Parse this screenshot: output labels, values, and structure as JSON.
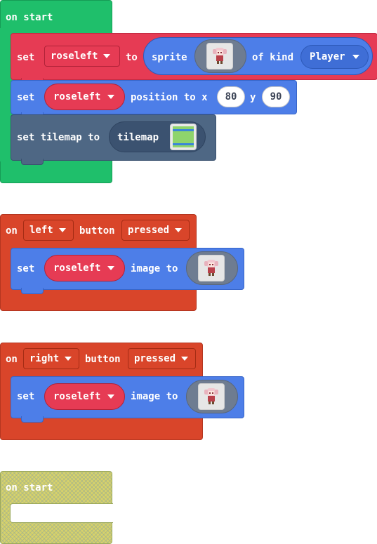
{
  "colors": {
    "on_start_green": "#1fbf6b",
    "controller_orange": "#d9452a",
    "variable_red": "#e63b54",
    "sprite_blue": "#4d7ee8",
    "scene_slate": "#4e6784",
    "disabled_yellow": "#d7d26a"
  },
  "start_block": {
    "header": "on start",
    "set_var": {
      "set": "set",
      "variable": "roseleft",
      "to": "to",
      "sprite_reporter": {
        "label": "sprite",
        "image": "rose-sprite-icon",
        "of_kind": "of kind",
        "kind": "Player"
      }
    },
    "set_position": {
      "set": "set",
      "variable": "roseleft",
      "position_to_x": "position to x",
      "x": "80",
      "y_label": "y",
      "y": "90"
    },
    "set_tilemap": {
      "label": "set tilemap to",
      "reporter": "tilemap",
      "image": "tilemap-icon"
    }
  },
  "left_block": {
    "on": "on",
    "button": "left",
    "button_label": "button",
    "event": "pressed",
    "set": "set",
    "variable": "roseleft",
    "image_to": "image to",
    "image": "rose-sprite-icon"
  },
  "right_block": {
    "on": "on",
    "button": "right",
    "button_label": "button",
    "event": "pressed",
    "set": "set",
    "variable": "roseleft",
    "image_to": "image to",
    "image": "rose-sprite-icon"
  },
  "disabled_block": {
    "header": "on start"
  }
}
